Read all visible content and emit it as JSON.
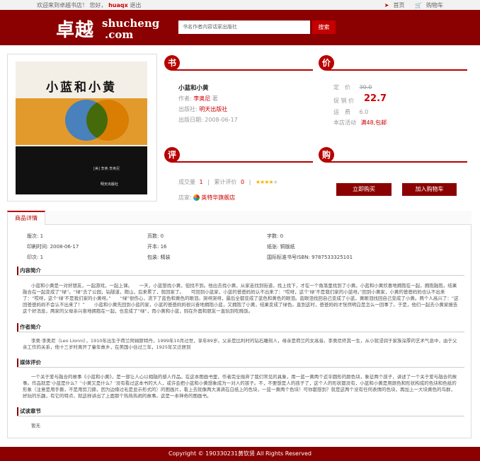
{
  "topbar": {
    "welcome": "欢迎来到卓越书店！",
    "greeting": "您好，",
    "username": "huaqx",
    "logout": "退出",
    "home": "首页",
    "cart": "购物车"
  },
  "header": {
    "logo_cn": "卓越",
    "logo_en_1": "shucheng",
    "logo_en_2": ".com",
    "search_placeholder": "书名作者内容话家出版社",
    "search_button": "搜索"
  },
  "cover": {
    "title": "小蓝和小黄",
    "author_line": "[美] 李奥·李奥尼",
    "publisher": "明天出版社"
  },
  "sections": {
    "book": "书",
    "price": "价",
    "review": "评",
    "buy": "购"
  },
  "book": {
    "title": "小蓝和小黄",
    "author_label": "作者:",
    "author": "李奥尼",
    "author_suffix": "著",
    "publisher_label": "出版社:",
    "publisher": "明天出版社",
    "date_label": "出版日期:",
    "date": "2008-06-17"
  },
  "price": {
    "list_label": "定　价",
    "list_value": "30.0",
    "sale_label": "促 销 价",
    "sale_value": "22.7",
    "shipping_label": "运　费",
    "shipping_value": "6.0",
    "promo_label": "本店活动",
    "promo_value": "满48,包邮"
  },
  "review": {
    "sales_label": "成交量",
    "sales_value": "1",
    "sep": "|",
    "rating_count_label": "累计评价",
    "rating_count_value": "0",
    "stars": 4,
    "max_stars": 5,
    "shop_label": "店家:",
    "shop_name": "英特华旗舰店"
  },
  "buy": {
    "buy_now": "立即购买",
    "add_cart": "加入购物车"
  },
  "detail": {
    "tab": "商品详情",
    "info": [
      [
        "版次:",
        "1",
        "页数:",
        "0",
        "字数:",
        "0"
      ],
      [
        "印刷时间:",
        "2008-06-17",
        "开本:",
        "16",
        "纸张:",
        "铜版纸"
      ],
      [
        "印次:",
        "1",
        "包装:",
        "精装",
        "国际标准书号ISBN:",
        "9787533325101"
      ]
    ],
    "sections": [
      {
        "title": "内容简介",
        "text": "小蓝和小黄是一对好朋友，一起游戏，一起上课。　　一天，小蓝想找小黄，但找不到。他出去找小黄，从家走找到街道，找上找下，才在一个角落里找到了小黄。小蓝和小黄欣喜地拥抱在一起，拥抱融抱，结果融合在一起变成了“绿”。“绿”去了公园，钻隧道，爬山，后来累了，就回家了。　　可回到小蓝家，小蓝的爸爸妈妈认不出来了：“哎呀，这个‘绿’不是我们家的小蓝呀。”回到小黄家，小黄的爸爸妈妈也认不出来了：“哎呀，这个‘绿’不是我们家的小黄呀。”　　“绿”很伤心，流下了蓝色和黄色的眼泪。哭呀哭呀，最后全都变成了蓝色和黄色的眼泪。蓝眼泪找回自己变成了小蓝，黄眼泪找回自己变成了小黄。两个人高兴了：“这回爸爸妈妈不会认不出来了！”　　小蓝和小黄先回到小蓝的家，小蓝的爸爸妈妈很兴奋地拥抱小蓝，又拥抱了小黄，结果变成了绿色。直到这时，爸爸妈妈才恍然明白是怎么一回事了。于是，他们一起去小黄家报告这个好消息，两家的父母亲兴奋地拥抱在一起，也变成了“绿”，而小黄和小蓝，则在外面和朋友一直玩到吃晚饭。"
      },
      {
        "title": "作者简介",
        "text": "李奥·李奥尼（Leo Lionni），1910年出生于荷兰阿姆斯特丹，1999年10月过世，享年89岁。父亲是比利时的钻石雕刻人，母亲是荷兰的女高音。李奥尼终其一生，从小就浸润于家族深厚的艺术气息中，由于父亲工作的关系，他十三岁时离开了童年故乡，在美国小住过三年，1925年又迁居到"
      },
      {
        "title": "媒体评价",
        "text": "一个关于爱与融合的故事《小蓝和小黄》，是一部让人心以相融的感人作品。在这本图画书里，作者完全抛弃了我们常见的具象，用一蓝一黄两个近乎圆形的颜色块，象征两个孩子，讲述了一个关于爱与融合的故事。作品就是‘小蓝是什么？’‘小黄又是什么？’没有看过这本书的大人，或许会把小蓝和小黄想象成为一对人的孩子。不，不要想是人的孩子了，这个人的形状都没有，小蓝和小黄是用颜色和形状构成的色块和色纸的形象（注意是用手撕，不是用剪刀撕，因为边缘过毛是显示形式的）的图画片，看上去就像两大滴滴在白纸上的色块，一蓝一黄两个色块！可你都想到？就是这两个没有任何表情的色块，再加上一大块黄色的鸟群，好玩的乐趣，有它的特点，就这样讲出了上面那个热热热闹的故事。这是一本神奇的图画书。"
      },
      {
        "title": "试读章节",
        "text": "暂无"
      }
    ]
  },
  "footer": {
    "text": "Copyright © 190330231黄钦贤 All Rights Reserved"
  },
  "colors": {
    "brand": "#8b0000",
    "accent": "#b80000",
    "price": "#cc0000"
  }
}
